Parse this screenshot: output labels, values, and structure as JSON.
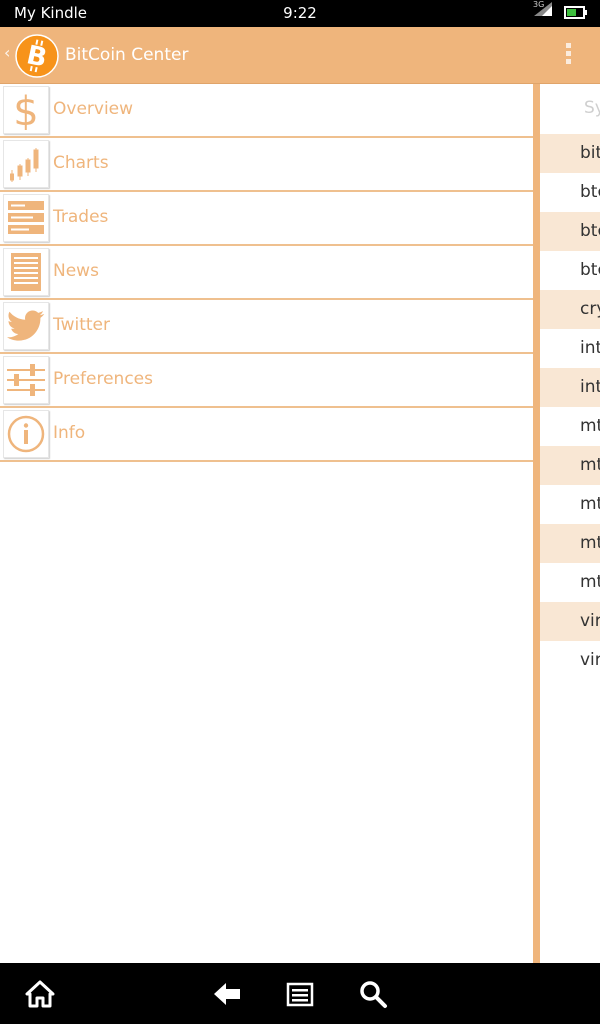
{
  "status_bar": {
    "carrier": "My Kindle",
    "time": "9:22",
    "network": "3G"
  },
  "app_bar": {
    "title": "BitCoin Center",
    "accent_color": "#efb57c"
  },
  "menu": {
    "items": [
      {
        "label": "Overview",
        "icon": "dollar-icon"
      },
      {
        "label": "Charts",
        "icon": "candlestick-chart-icon"
      },
      {
        "label": "Trades",
        "icon": "trades-list-icon"
      },
      {
        "label": "News",
        "icon": "news-document-icon"
      },
      {
        "label": "Twitter",
        "icon": "twitter-bird-icon"
      },
      {
        "label": "Preferences",
        "icon": "sliders-icon"
      },
      {
        "label": "Info",
        "icon": "info-icon"
      }
    ]
  },
  "content": {
    "column_header": "Sy",
    "rows": [
      "bit",
      "btc",
      "btc",
      "btc",
      "cry",
      "int",
      "int",
      "mt",
      "mt",
      "mt",
      "mt",
      "mt",
      "vir",
      "vir"
    ]
  }
}
